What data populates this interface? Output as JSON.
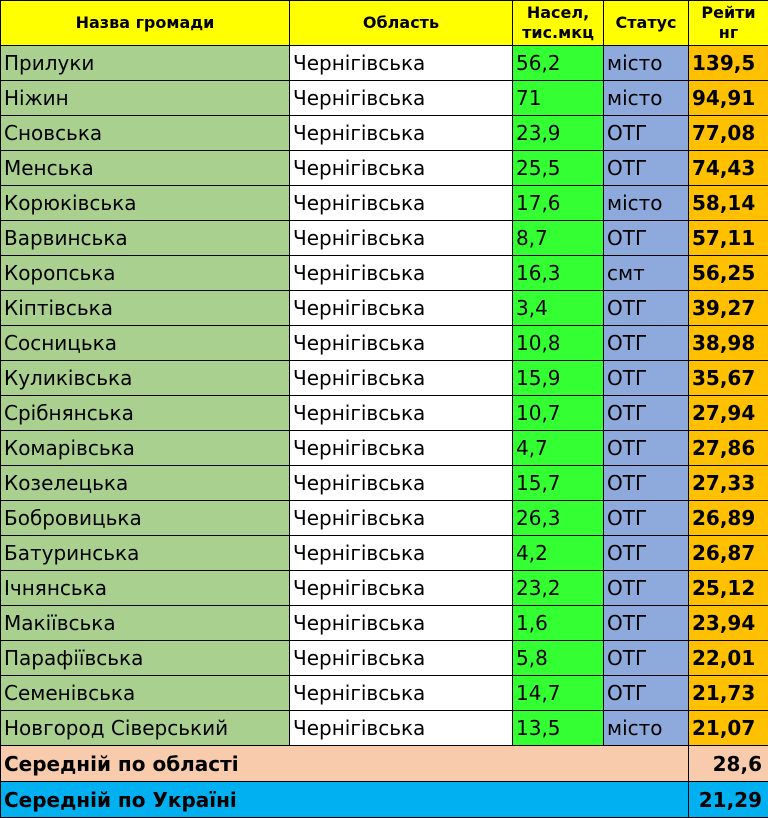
{
  "headers": {
    "name": "Назва громади",
    "oblast": "Область",
    "population_line1": "Насел,",
    "population_line2": "тис.мкц",
    "status": "Статус",
    "rating_line1": "Рейти",
    "rating_line2": "нг"
  },
  "rows": [
    {
      "name": "Прилуки",
      "oblast": "Чернігівська",
      "population": "56,2",
      "status": "місто",
      "rating": "139,5"
    },
    {
      "name": "Ніжин",
      "oblast": "Чернігівська",
      "population": "71",
      "status": "місто",
      "rating": "94,91"
    },
    {
      "name": "Сновська",
      "oblast": "Чернігівська",
      "population": "23,9",
      "status": "ОТГ",
      "rating": "77,08"
    },
    {
      "name": "Менська",
      "oblast": "Чернігівська",
      "population": "25,5",
      "status": "ОТГ",
      "rating": "74,43"
    },
    {
      "name": "Корюківська",
      "oblast": "Чернігівська",
      "population": "17,6",
      "status": "місто",
      "rating": "58,14"
    },
    {
      "name": "Варвинська",
      "oblast": "Чернігівська",
      "population": "8,7",
      "status": "ОТГ",
      "rating": "57,11"
    },
    {
      "name": "Коропська",
      "oblast": "Чернігівська",
      "population": "16,3",
      "status": "смт",
      "rating": "56,25"
    },
    {
      "name": "Кіптівська",
      "oblast": "Чернігівська",
      "population": "3,4",
      "status": "ОТГ",
      "rating": "39,27"
    },
    {
      "name": "Сосницька",
      "oblast": "Чернігівська",
      "population": "10,8",
      "status": "ОТГ",
      "rating": "38,98"
    },
    {
      "name": "Куликівська",
      "oblast": "Чернігівська",
      "population": "15,9",
      "status": "ОТГ",
      "rating": "35,67"
    },
    {
      "name": "Срібнянська",
      "oblast": "Чернігівська",
      "population": "10,7",
      "status": "ОТГ",
      "rating": "27,94"
    },
    {
      "name": "Комарівська",
      "oblast": "Чернігівська",
      "population": "4,7",
      "status": "ОТГ",
      "rating": "27,86"
    },
    {
      "name": "Козелецька",
      "oblast": "Чернігівська",
      "population": "15,7",
      "status": "ОТГ",
      "rating": "27,33"
    },
    {
      "name": "Бобровицька",
      "oblast": "Чернігівська",
      "population": "26,3",
      "status": "ОТГ",
      "rating": "26,89"
    },
    {
      "name": "Батуринська",
      "oblast": "Чернігівська",
      "population": "4,2",
      "status": "ОТГ",
      "rating": "26,87"
    },
    {
      "name": "Ічнянська",
      "oblast": "Чернігівська",
      "population": "23,2",
      "status": "ОТГ",
      "rating": "25,12"
    },
    {
      "name": "Макіївська",
      "oblast": "Чернігівська",
      "population": "1,6",
      "status": "ОТГ",
      "rating": "23,94"
    },
    {
      "name": "Парафіївська",
      "oblast": "Чернігівська",
      "population": "5,8",
      "status": "ОТГ",
      "rating": "22,01"
    },
    {
      "name": "Семенівська",
      "oblast": "Чернігівська",
      "population": "14,7",
      "status": "ОТГ",
      "rating": "21,73"
    },
    {
      "name": "Новгород Сіверський",
      "oblast": "Чернігівська",
      "population": "13,5",
      "status": "місто",
      "rating": "21,07"
    }
  ],
  "summary": {
    "oblast_label": "Середній по області",
    "oblast_value": "28,6",
    "ukraine_label": "Середній по Україні",
    "ukraine_value": "21,29"
  },
  "colors": {
    "header": "#ffff00",
    "name_col": "#a9d08e",
    "population_col": "#33ff33",
    "status_col": "#8ea9db",
    "rating_col": "#ffc000",
    "avg_oblast": "#f8cbad",
    "avg_ukraine": "#00b0f0"
  }
}
